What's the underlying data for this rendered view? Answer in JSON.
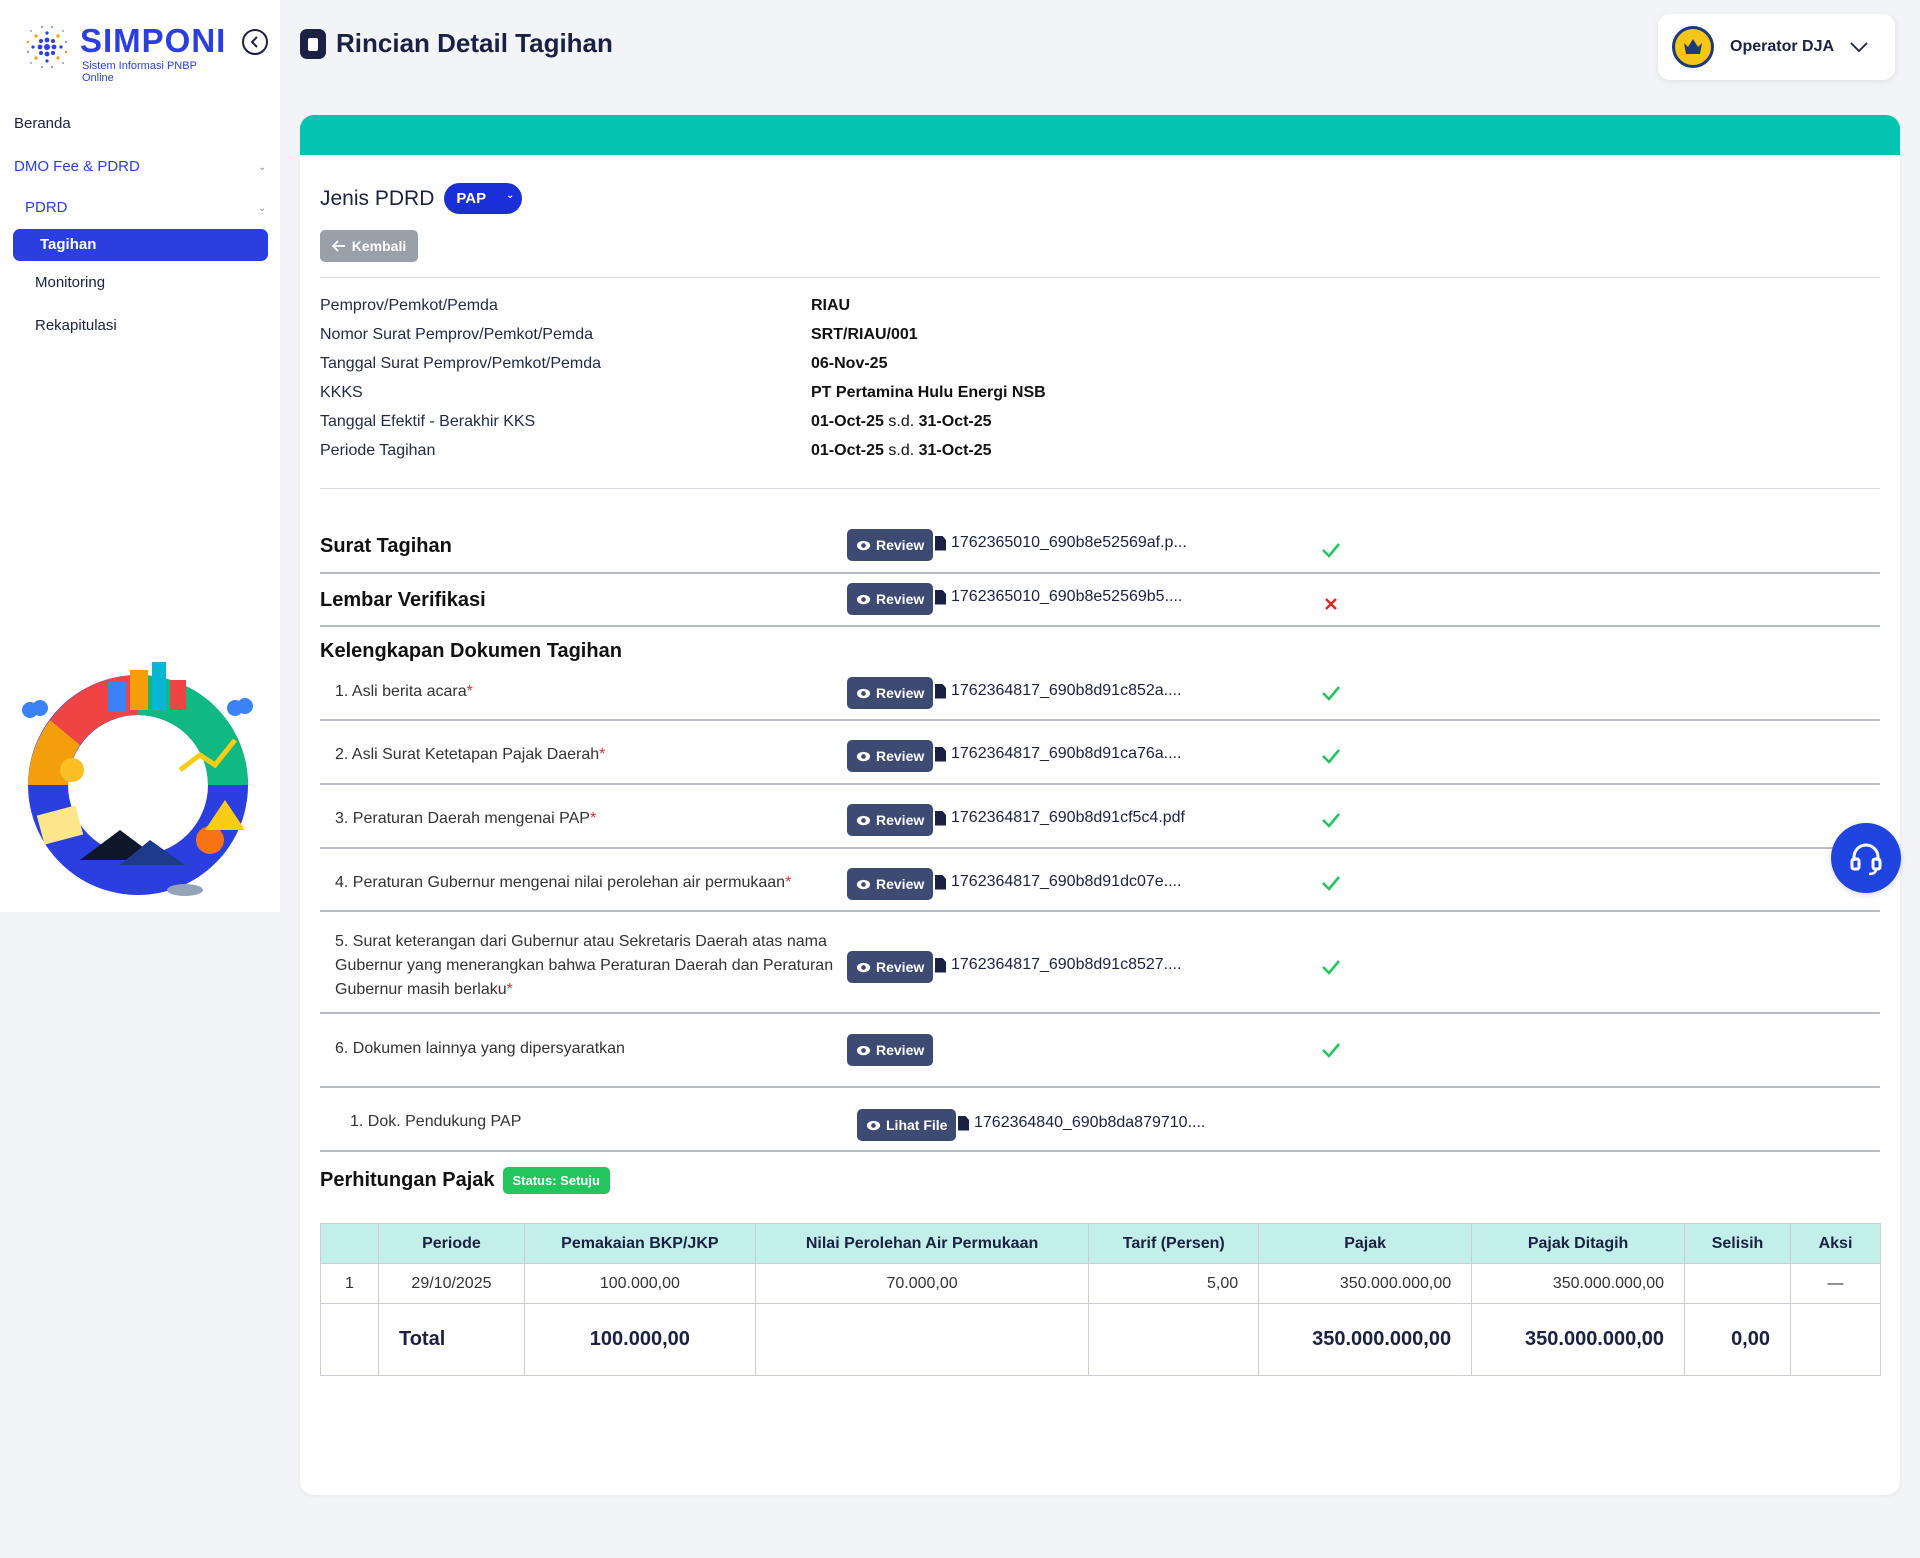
{
  "app": {
    "logo_title": "SIMPONI",
    "logo_subtitle": "Sistem Informasi PNBP Online",
    "accent_color": "#2b3ee0",
    "teal_color": "#03c4b0"
  },
  "sidebar": {
    "items": [
      {
        "label": "Beranda"
      },
      {
        "label": "DMO Fee & PDRD"
      },
      {
        "label": "PDRD"
      },
      {
        "label": "Tagihan"
      },
      {
        "label": "Monitoring"
      },
      {
        "label": "Rekapitulasi"
      }
    ]
  },
  "header": {
    "title": "Rincian Detail Tagihan",
    "user_name": "Operator DJA"
  },
  "filter": {
    "jenis_label": "Jenis PDRD",
    "jenis_value": "PAP"
  },
  "back_label": "Kembali",
  "info": [
    {
      "label": "Pemprov/Pemkot/Pemda",
      "value": "RIAU"
    },
    {
      "label": "Nomor Surat Pemprov/Pemkot/Pemda",
      "value": "SRT/RIAU/001"
    },
    {
      "label": "Tanggal Surat Pemprov/Pemkot/Pemda",
      "value": "06-Nov-25"
    },
    {
      "label": "KKKS",
      "value": "PT Pertamina Hulu Energi NSB"
    },
    {
      "label": "Tanggal Efektif - Berakhir KKS",
      "start": "01-Oct-25",
      "sep": "s.d.",
      "end": "31-Oct-25"
    },
    {
      "label": "Periode Tagihan",
      "start": "01-Oct-25",
      "sep": "s.d.",
      "end": "31-Oct-25"
    }
  ],
  "surat_tagihan": {
    "title": "Surat Tagihan",
    "button": "Review",
    "file": "1762365010_690b8e52569af.p...",
    "status": "ok"
  },
  "lembar_verifikasi": {
    "title": "Lembar Verifikasi",
    "button": "Review",
    "file": "1762365010_690b8e52569b5....",
    "status": "rejected"
  },
  "kelengkapan": {
    "title": "Kelengkapan Dokumen Tagihan",
    "docs": [
      {
        "label": "1. Asli berita acara",
        "required_mark": "*",
        "button": "Review",
        "file": "1762364817_690b8d91c852a....",
        "status": "ok"
      },
      {
        "label": "2. Asli Surat Ketetapan Pajak Daerah",
        "required_mark": "*",
        "button": "Review",
        "file": "1762364817_690b8d91ca76a....",
        "status": "ok"
      },
      {
        "label": "3. Peraturan Daerah mengenai PAP",
        "required_mark": "*",
        "button": "Review",
        "file": "1762364817_690b8d91cf5c4.pdf",
        "status": "ok"
      },
      {
        "label": "4. Peraturan Gubernur mengenai nilai perolehan air permukaan",
        "required_mark": "*",
        "button": "Review",
        "file": "1762364817_690b8d91dc07e....",
        "status": "ok"
      },
      {
        "label": "5. Surat keterangan dari Gubernur atau Sekretaris Daerah atas nama Gubernur yang menerangkan bahwa Peraturan Daerah dan Peraturan Gubernur masih berlaku",
        "required_mark": "*",
        "button": "Review",
        "file": "1762364817_690b8d91c8527....",
        "status": "ok"
      },
      {
        "label": "6. Dokumen lainnya yang dipersyaratkan",
        "required_mark": "",
        "button": "Review",
        "file": "",
        "status": "ok"
      }
    ],
    "sub_docs": [
      {
        "label": "1. Dok. Pendukung PAP",
        "button": "Lihat File",
        "file": "1762364840_690b8da879710...."
      }
    ]
  },
  "perhitungan": {
    "title": "Perhitungan Pajak",
    "status_badge": "Status: Setuju",
    "columns": [
      "",
      "Periode",
      "Pemakaian BKP/JKP",
      "Nilai Perolehan Air Permukaan",
      "Tarif (Persen)",
      "Pajak",
      "Pajak Ditagih",
      "Selisih",
      "Aksi"
    ],
    "rows": [
      [
        "1",
        "29/10/2025",
        "100.000,00",
        "70.000,00",
        "5,00",
        "350.000.000,00",
        "350.000.000,00",
        "",
        "—"
      ]
    ],
    "total": {
      "label": "Total",
      "pemakaian": "100.000,00",
      "pajak": "350.000.000,00",
      "pajak_ditagih": "350.000.000,00",
      "selisih": "0,00"
    }
  },
  "pager": {
    "first": "«",
    "prev": "‹",
    "next": "›",
    "last": "»"
  }
}
